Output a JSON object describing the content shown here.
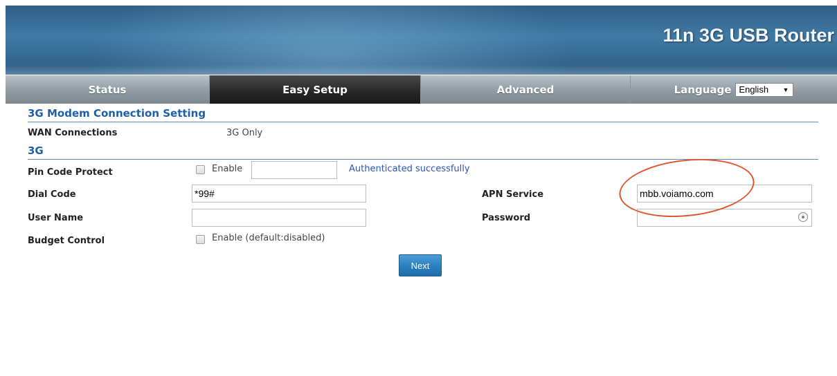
{
  "header": {
    "title": "11n 3G USB Router"
  },
  "nav": {
    "tabs": [
      {
        "label": "Status"
      },
      {
        "label": "Easy Setup"
      },
      {
        "label": "Advanced"
      },
      {
        "label": "Language"
      }
    ],
    "language_value": "English"
  },
  "form": {
    "section_title": "3G Modem Connection Setting",
    "wan_label": "WAN Connections",
    "wan_value": "3G Only",
    "subsection_title": "3G",
    "pin_label": "Pin Code Protect",
    "pin_enable_label": "Enable",
    "pin_value": "",
    "pin_status": "Authenticated successfully",
    "dial_label": "Dial Code",
    "dial_value": "*99#",
    "apn_label": "APN Service",
    "apn_value": "mbb.voiamo.com",
    "user_label": "User Name",
    "user_value": "",
    "password_label": "Password",
    "password_value": "",
    "budget_label": "Budget Control",
    "budget_enable_label": "Enable (default:disabled)",
    "next_label": "Next"
  },
  "colors": {
    "accent": "#1f5faa",
    "highlight": "#e0552e",
    "button": "#2a7fbe"
  }
}
